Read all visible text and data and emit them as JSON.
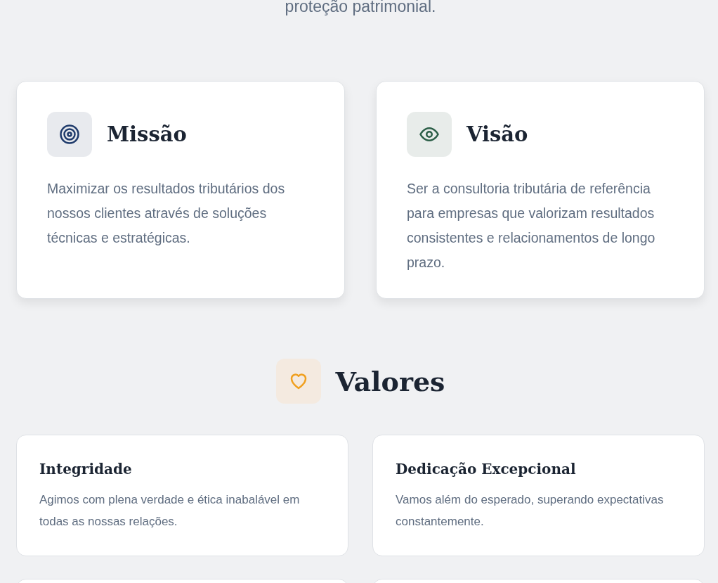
{
  "intro": {
    "text": "proteção patrimonial."
  },
  "cards": [
    {
      "kind": "target",
      "title": "Missão",
      "text": "Maximizar os resultados tributários dos nossos clientes através de soluções técnicas e estratégicas."
    },
    {
      "kind": "eye",
      "title": "Visão",
      "text": "Ser a consultoria tributária de referência para empresas que valorizam resultados consistentes e relacionamentos de longo prazo."
    }
  ],
  "values": {
    "title": "Valores",
    "items": [
      {
        "title": "Integridade",
        "text": "Agimos com plena verdade e ética inabalável em todas as nossas relações."
      },
      {
        "title": "Dedicação Excepcional",
        "text": "Vamos além do esperado, superando expectativas constantemente."
      }
    ]
  }
}
